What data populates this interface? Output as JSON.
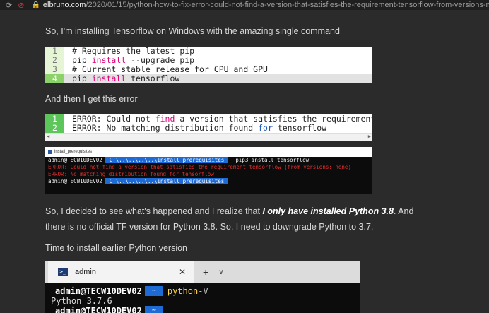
{
  "browser": {
    "domain": "elbruno.com",
    "path": "/2020/01/15/python-how-to-fix-error-could-not-find-a-version-that-satisfies-the-requirement-tensorflow-from-versions-none"
  },
  "article": {
    "p1": "So, I'm installing Tensorflow on Windows with the amazing single command",
    "p2": "And then I get this error",
    "p3_a": "So, I decided to see what's happened and I realize that ",
    "p3_b": "I only have installed Python 3.8",
    "p3_c": ". And",
    "p3_d": "there is no official TF version for Python 3.8. So, I need to downgrade Python to 3.7.",
    "p4": "Time to install earlier Python version"
  },
  "code1": {
    "lines": [
      {
        "num": "1",
        "text": "# Requires the latest pip"
      },
      {
        "num": "2",
        "a": "pip ",
        "kw": "install",
        "b": " --upgrade pip"
      },
      {
        "num": "3",
        "text": "# Current stable release for CPU and GPU"
      },
      {
        "num": "4",
        "a": "pip ",
        "kw": "install",
        "b": " tensorflow"
      }
    ]
  },
  "code2": {
    "lines": [
      {
        "num": "1",
        "a": "ERROR: Could not ",
        "kw": "find",
        "b": " a version that satisfies the requirement te"
      },
      {
        "num": "2",
        "a": "ERROR: No matching distribution found ",
        "kw": "for",
        "b": " tensorflow"
      }
    ]
  },
  "terminal1": {
    "title": "install_prerequisites",
    "user": "admin@TECW10DEV02",
    "path": "C:\\..\\..\\..\\..\\install_prerequisites",
    "command": "pip3 install tensorflow",
    "error1": "ERROR: Could not find a version that satisfies the requirement tensorflow (from versions: none)",
    "error2": "ERROR: No matching distribution found for tensorflow"
  },
  "terminal2": {
    "tab_title": "admin",
    "ps_icon": ">_",
    "user": "admin@TECW10DEV02",
    "arrow": "~",
    "cmd": "python",
    "arg": " -V",
    "output": "Python 3.7.6"
  }
}
